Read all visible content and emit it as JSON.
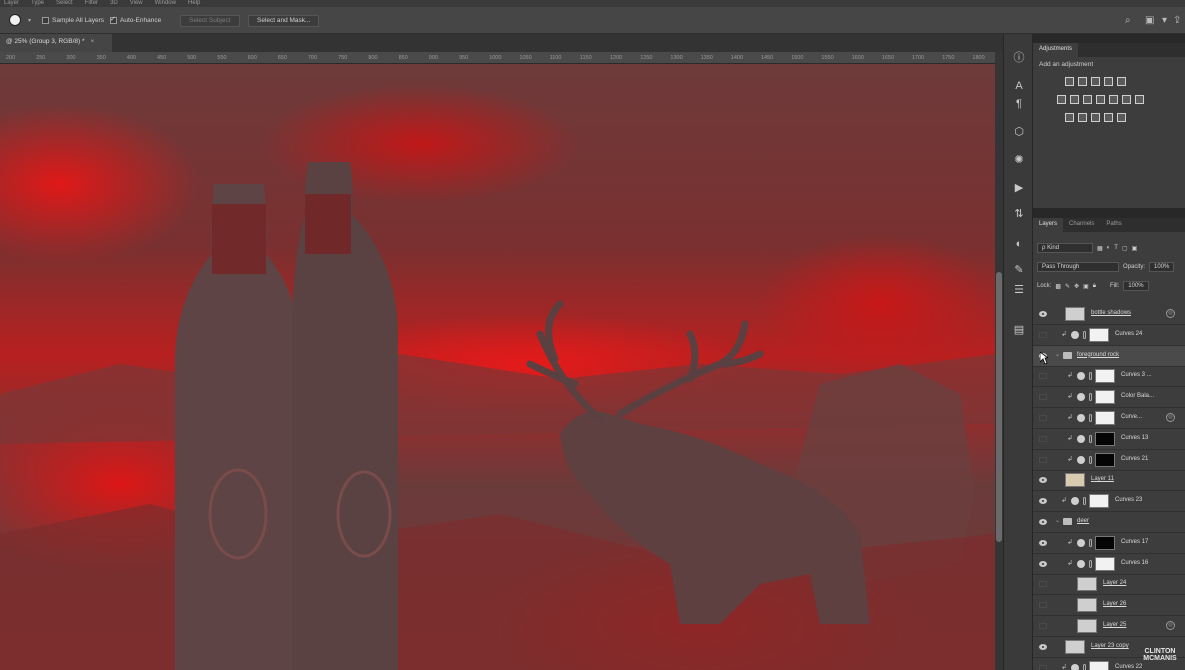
{
  "menu": [
    "Layer",
    "Type",
    "Select",
    "Filter",
    "3D",
    "View",
    "Window",
    "Help"
  ],
  "options": {
    "sample_all_layers": "Sample All Layers",
    "sample_all_checked": false,
    "auto_enhance": "Auto-Enhance",
    "auto_enhance_checked": true,
    "select_subject": "Select Subject",
    "select_and_mask": "Select and Mask..."
  },
  "document_tab": {
    "title": "@ 25% (Group 3, RGB/8) *",
    "close": "×"
  },
  "ruler_ticks": [
    "200",
    "250",
    "300",
    "350",
    "400",
    "450",
    "500",
    "550",
    "600",
    "650",
    "700",
    "750",
    "800",
    "850",
    "900",
    "950",
    "1000",
    "1050",
    "1100",
    "1150",
    "1200",
    "1250",
    "1300",
    "1350",
    "1400",
    "1450",
    "1500",
    "1550",
    "1600",
    "1650",
    "1700",
    "1750",
    "1800"
  ],
  "panels": {
    "adjustments_tab": "Adjustments",
    "add_adjustment": "Add an adjustment",
    "layers_tab": "Layers",
    "channels_tab": "Channels",
    "paths_tab": "Paths",
    "filter_kind": "ρ Kind",
    "blend_mode": "Pass Through",
    "opacity_label": "Opacity:",
    "opacity_value": "100%",
    "lock_label": "Lock:",
    "fill_label": "Fill:",
    "fill_value": "100%"
  },
  "layers": [
    {
      "name": "bottle shadows",
      "visible": true,
      "thumb": "gray",
      "type": "pixel",
      "indent": 0,
      "fx": true
    },
    {
      "name": "Curves 24",
      "visible": false,
      "thumb": "white",
      "type": "curves",
      "indent": 1
    },
    {
      "name": "foreground rock",
      "visible": true,
      "thumb": "",
      "type": "group",
      "indent": 0,
      "selected": true
    },
    {
      "name": "Curves 3 ...",
      "visible": false,
      "thumb": "white",
      "type": "curves",
      "indent": 2
    },
    {
      "name": "Color Bala...",
      "visible": false,
      "thumb": "white",
      "type": "curves",
      "indent": 2
    },
    {
      "name": "Curve...",
      "visible": false,
      "thumb": "white",
      "type": "curves",
      "indent": 2,
      "fx": true
    },
    {
      "name": "Curves 13",
      "visible": false,
      "thumb": "black",
      "type": "curves",
      "indent": 2
    },
    {
      "name": "Curves 21",
      "visible": false,
      "thumb": "black",
      "type": "curves",
      "indent": 2
    },
    {
      "name": "Layer 11",
      "visible": true,
      "thumb": "tan",
      "type": "pixel",
      "indent": 0
    },
    {
      "name": "Curves 23",
      "visible": true,
      "thumb": "white",
      "type": "curves",
      "indent": 1
    },
    {
      "name": "deer",
      "visible": true,
      "thumb": "",
      "type": "group",
      "indent": 0
    },
    {
      "name": "Curves 17",
      "visible": true,
      "thumb": "black",
      "type": "curves",
      "indent": 2
    },
    {
      "name": "Curves 16",
      "visible": true,
      "thumb": "white",
      "type": "curves",
      "indent": 2
    },
    {
      "name": "Layer 24",
      "visible": false,
      "thumb": "gray",
      "type": "pixel",
      "indent": 2
    },
    {
      "name": "Layer 26",
      "visible": false,
      "thumb": "gray",
      "type": "pixel",
      "indent": 2
    },
    {
      "name": "Layer 25",
      "visible": false,
      "thumb": "gray",
      "type": "pixel",
      "indent": 2,
      "fx": true
    },
    {
      "name": "Layer 23 copy",
      "visible": true,
      "thumb": "gray",
      "type": "pixel",
      "indent": 0
    },
    {
      "name": "Curves 22",
      "visible": false,
      "thumb": "white",
      "type": "curves",
      "indent": 1
    }
  ],
  "watermark": "CLINTON MCMANIS"
}
